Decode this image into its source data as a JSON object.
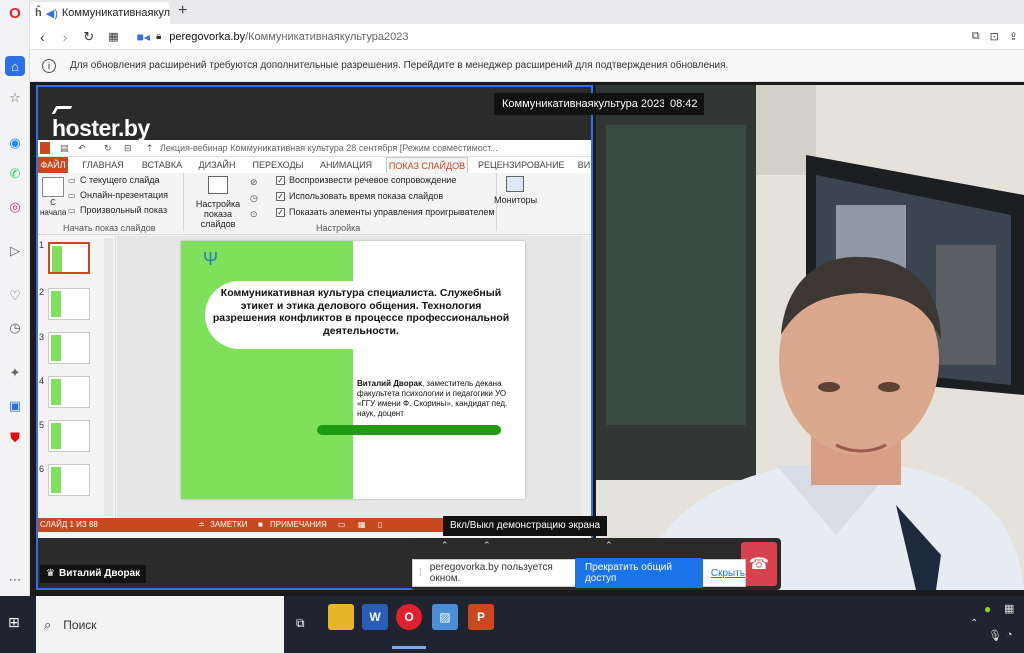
{
  "browser": {
    "tab_title": "Коммуникативнаякультура",
    "new_tab_glyph": "+",
    "url_host": "peregovorka.by",
    "url_path": "/Коммуникативнаякультура2023",
    "info_message": "Для обновления расширений требуются дополнительные разрешения. Перейдите в менеджер расширений для подтверждения обновления."
  },
  "meeting": {
    "room_name": "Коммуникативнаякультура 2023",
    "timer": "08:42",
    "presenter_name": "Виталий Дворак",
    "tooltip": "Вкл/Выкл демонстрацию экрана",
    "share_notice": "peregovorka.by пользуется окном.",
    "stop_share_label": "Прекратить общий доступ",
    "hide_label": "Скрыть"
  },
  "shared_screen": {
    "logo": "hoster.by",
    "ppt_title": "Лекция-вебинар Коммуникативная культура 28 сентября [Режим совместимост...",
    "ribbon_tabs": [
      "ФАЙЛ",
      "ГЛАВНАЯ",
      "ВСТАВКА",
      "ДИЗАЙН",
      "ПЕРЕХОДЫ",
      "АНИМАЦИЯ",
      "ПОКАЗ СЛАЙДОВ",
      "РЕЦЕНЗИРОВАНИЕ",
      "ВИ"
    ],
    "ribbon": {
      "from_start": "С начала",
      "from_current": "С текущего слайда",
      "online": "Онлайн-презентация",
      "custom": "Произвольный показ",
      "group1": "Начать показ слайдов",
      "setup": "Настройка показа слайдов",
      "opt1": "Воспроизвести речевое сопровождение",
      "opt2": "Использовать время показа слайдов",
      "opt3": "Показать элементы управления проигрывателем",
      "group2": "Настройка",
      "monitors": "Мониторы"
    },
    "thumb_numbers": [
      "1",
      "2",
      "3",
      "4",
      "5",
      "6"
    ],
    "slide": {
      "title": "Коммуникативная культура специалиста. Служебный этикет и этика делового общения. Технология разрешения конфликтов в процессе профессиональной деятельности.",
      "author_name": "Виталий Дворак",
      "author_details": ", заместитель декана факультета психологии и педагогики УО «ГГУ имени Ф. Скорины», кандидат пед. наук, доцент"
    },
    "status_slide": "СЛАЙД 1 ИЗ 88",
    "status_notes": "ЗАМЕТКИ",
    "status_comments": "ПРИМЕЧАНИЯ"
  },
  "taskbar": {
    "search_placeholder": "Поиск"
  },
  "colors": {
    "accent_blue": "#3a6cf0",
    "ppt_orange": "#c8491f",
    "slide_green": "#7fe05c",
    "stop_button": "#1a73e8",
    "hangup_red": "#d9414e"
  }
}
